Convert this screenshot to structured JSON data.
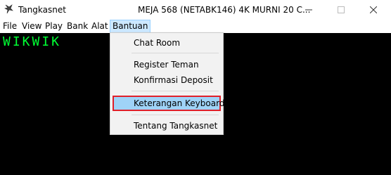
{
  "window": {
    "app_name": "Tangkasnet",
    "title": "MEJA 568 (NETABK146) 4K MURNI 20 C...",
    "app_icon": "bird-icon",
    "controls": [
      "minimize-icon",
      "maximize-icon",
      "close-icon"
    ]
  },
  "menubar": {
    "items": [
      {
        "label": "File"
      },
      {
        "label": "View"
      },
      {
        "label": "Play"
      },
      {
        "label": "Bank"
      },
      {
        "label": "Alat"
      },
      {
        "label": "Bantuan",
        "active": true
      }
    ]
  },
  "content": {
    "text": "WIKWIK",
    "text_color": "#00ff33",
    "background": "#000000"
  },
  "dropdown": {
    "items": [
      {
        "label": "Chat Room"
      },
      {
        "label": "Register Teman"
      },
      {
        "label": "Konfirmasi Deposit"
      },
      {
        "label": "Keterangan Keyboard",
        "highlighted": true
      },
      {
        "label": "Tentang Tangkasnet"
      }
    ],
    "highlight_color": "#9fd3f7",
    "highlight_border": "#e0202a"
  }
}
